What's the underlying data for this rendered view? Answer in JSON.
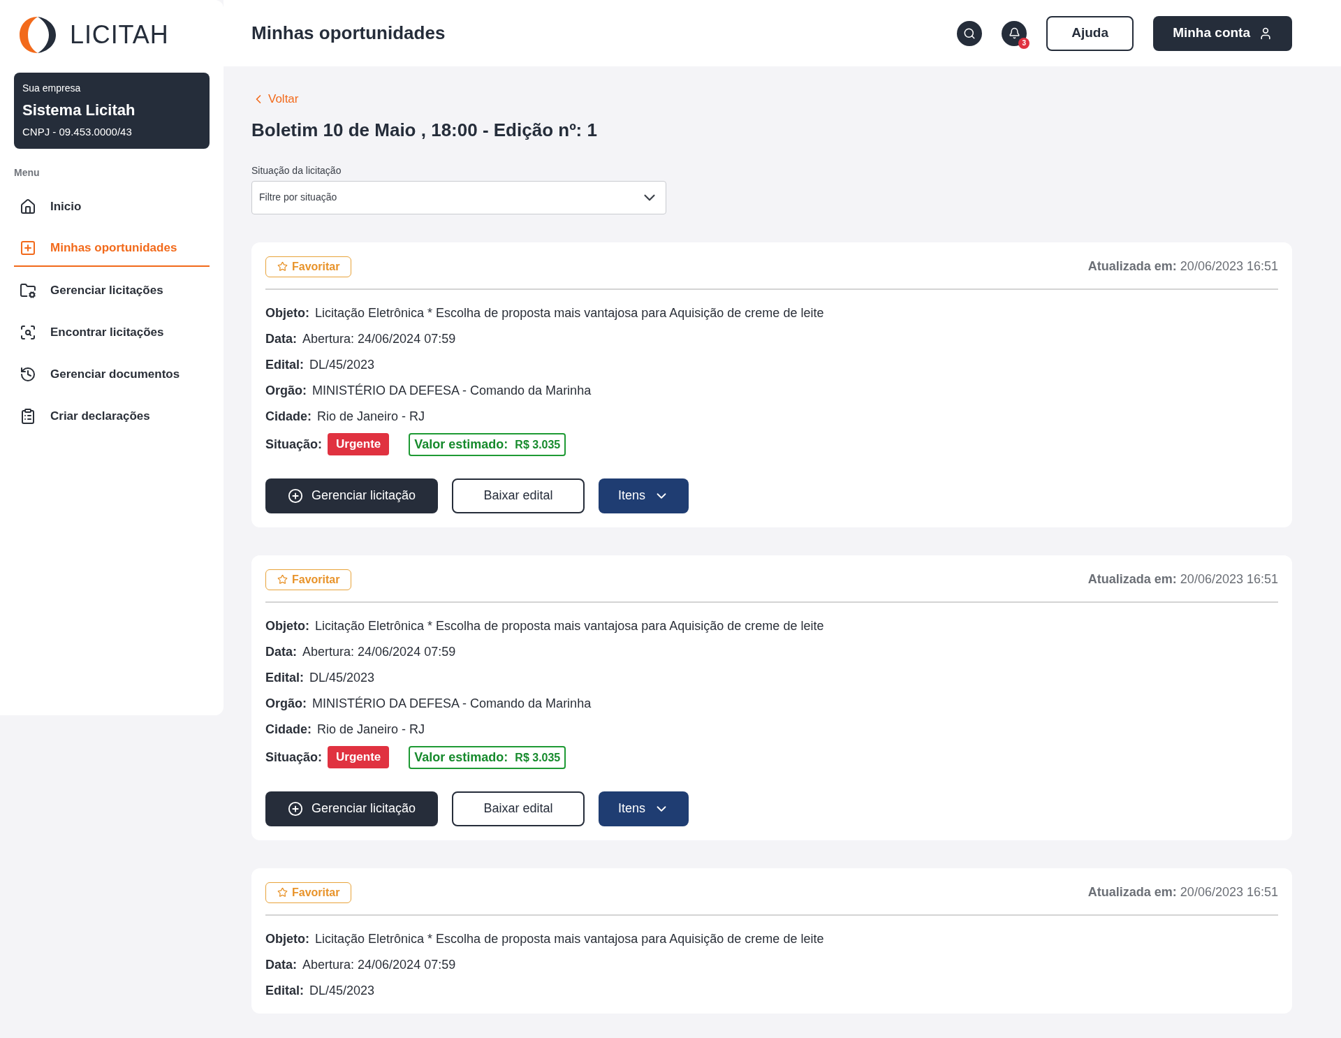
{
  "sidebar": {
    "logo_text": "LICITAH",
    "company": {
      "caption": "Sua empresa",
      "name": "Sistema Licitah",
      "cnpj": "CNPJ - 09.453.0000/43"
    },
    "menu_title": "Menu",
    "items": [
      {
        "label": "Inicio",
        "selected": false
      },
      {
        "label": "Minhas oportunidades",
        "selected": true
      },
      {
        "label": "Gerenciar licitações",
        "selected": false
      },
      {
        "label": "Encontrar licitações",
        "selected": false
      },
      {
        "label": "Gerenciar documentos",
        "selected": false
      },
      {
        "label": "Criar declarações",
        "selected": false
      }
    ]
  },
  "header": {
    "title": "Minhas oportunidades",
    "notification_count": "3",
    "help_button": "Ajuda",
    "account_button": "Minha conta"
  },
  "back_link": "Voltar",
  "page_title": "Boletim 10 de Maio , 18:00 - Edição nº: 1",
  "filter": {
    "label": "Situação da licitação",
    "placeholder": "Filtre por situação"
  },
  "cards": [
    {
      "favorite": "Favoritar",
      "updated_label": "Atualizada em:",
      "updated_value": "20/06/2023 16:51",
      "fields": [
        {
          "label": "Objeto:",
          "value": "Licitação Eletrônica * Escolha de proposta mais vantajosa para Aquisição de creme de leite"
        },
        {
          "label": "Data:",
          "value": "Abertura: 24/06/2024 07:59"
        },
        {
          "label": "Edital:",
          "value": "DL/45/2023"
        },
        {
          "label": "Orgão:",
          "value": "MINISTÉRIO DA DEFESA - Comando da Marinha"
        },
        {
          "label": "Cidade:",
          "value": "Rio de Janeiro - RJ"
        }
      ],
      "situation_label": "Situação:",
      "status": "Urgente",
      "estimate_label": "Valor estimado:",
      "estimate_value": "R$ 3.035",
      "buttons": {
        "manage": "Gerenciar licitação",
        "download": "Baixar edital",
        "items": "Itens"
      }
    },
    {
      "favorite": "Favoritar",
      "updated_label": "Atualizada em:",
      "updated_value": "20/06/2023 16:51",
      "fields": [
        {
          "label": "Objeto:",
          "value": "Licitação Eletrônica * Escolha de proposta mais vantajosa para Aquisição de creme de leite"
        },
        {
          "label": "Data:",
          "value": "Abertura: 24/06/2024 07:59"
        },
        {
          "label": "Edital:",
          "value": "DL/45/2023"
        },
        {
          "label": "Orgão:",
          "value": "MINISTÉRIO DA DEFESA - Comando da Marinha"
        },
        {
          "label": "Cidade:",
          "value": "Rio de Janeiro - RJ"
        }
      ],
      "situation_label": "Situação:",
      "status": "Urgente",
      "estimate_label": "Valor estimado:",
      "estimate_value": "R$ 3.035",
      "buttons": {
        "manage": "Gerenciar licitação",
        "download": "Baixar edital",
        "items": "Itens"
      }
    },
    {
      "favorite": "Favoritar",
      "updated_label": "Atualizada em:",
      "updated_value": "20/06/2023 16:51",
      "fields": [
        {
          "label": "Objeto:",
          "value": "Licitação Eletrônica * Escolha de proposta mais vantajosa para Aquisição de creme de leite"
        },
        {
          "label": "Data:",
          "value": "Abertura: 24/06/2024 07:59"
        },
        {
          "label": "Edital:",
          "value": "DL/45/2023"
        }
      ]
    }
  ]
}
